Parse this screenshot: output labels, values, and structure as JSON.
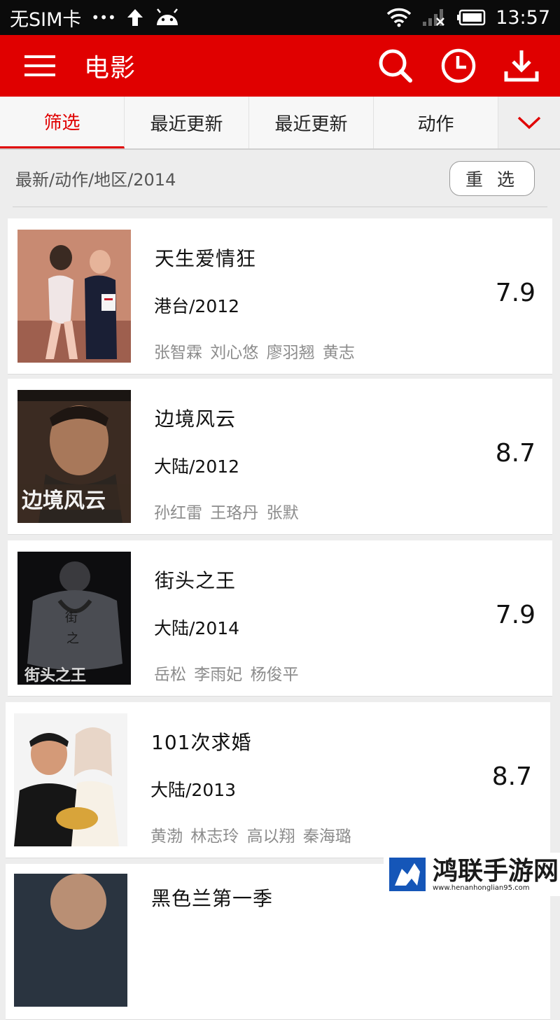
{
  "status": {
    "carrier": "无SIM卡",
    "dots": "•••",
    "time": "13:57"
  },
  "appbar": {
    "title": "电影",
    "color": "#e00000"
  },
  "tabs": [
    {
      "label": "筛选",
      "active": true
    },
    {
      "label": "最近更新"
    },
    {
      "label": "最近更新"
    },
    {
      "label": "动作"
    }
  ],
  "filter": {
    "path": "最新/动作/地区/2014",
    "reselect_label": "重 选"
  },
  "movies": [
    {
      "title": "天生爱情狂",
      "region_year": "港台/2012",
      "cast": "张智霖  刘心悠  廖羽翘  黄志",
      "rating": "7.9"
    },
    {
      "title": "边境风云",
      "region_year": "大陆/2012",
      "cast": "孙红雷  王珞丹  张默",
      "rating": "8.7"
    },
    {
      "title": "街头之王",
      "region_year": "大陆/2014",
      "cast": "岳松  李雨妃  杨俊平",
      "rating": "7.9"
    },
    {
      "title": "101次求婚",
      "region_year": "大陆/2013",
      "cast": "黄渤  林志玲  高以翔  秦海璐",
      "rating": "8.7"
    },
    {
      "title": "黑色兰第一季",
      "region_year": "",
      "cast": "",
      "rating": ""
    }
  ],
  "watermark": {
    "main": "鸿联手游网",
    "sub": "www.henanhonglian95.com"
  }
}
